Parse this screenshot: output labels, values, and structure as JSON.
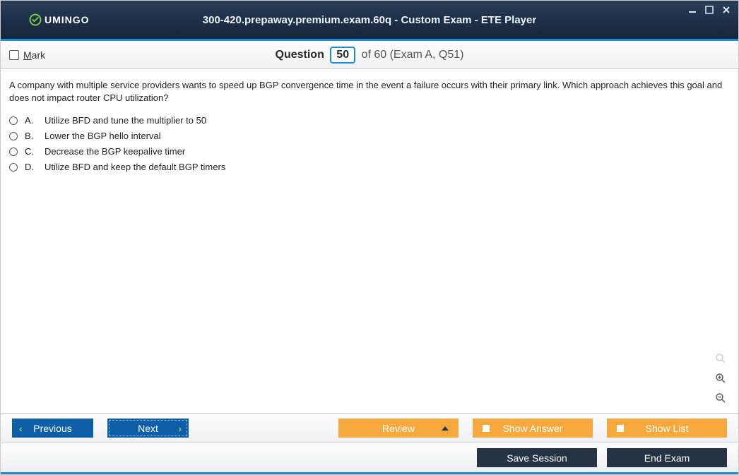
{
  "window": {
    "title": "300-420.prepaway.premium.exam.60q - Custom Exam - ETE Player",
    "logo_text": "UMINGO"
  },
  "header": {
    "mark_label_underlined": "M",
    "mark_label_rest": "ark",
    "question_label": "Question",
    "current_number": "50",
    "of_text": " of 60 (Exam A, Q51)"
  },
  "question": {
    "text": "A company with multiple service providers wants to speed up BGP convergence time in the event a failure occurs with their primary link. Which approach achieves this goal and does not impact router CPU utilization?",
    "options": [
      {
        "letter": "A.",
        "text": "Utilize BFD and tune the multiplier to 50"
      },
      {
        "letter": "B.",
        "text": "Lower the BGP hello interval"
      },
      {
        "letter": "C.",
        "text": "Decrease the BGP keepalive timer"
      },
      {
        "letter": "D.",
        "text": "Utilize BFD and keep the default BGP timers"
      }
    ]
  },
  "buttons": {
    "previous": "Previous",
    "next": "Next",
    "review": "Review",
    "show_answer": "Show Answer",
    "show_list": "Show List",
    "save_session": "Save Session",
    "end_exam": "End Exam"
  }
}
